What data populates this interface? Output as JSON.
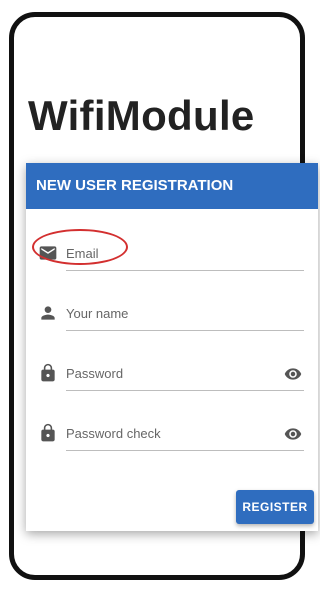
{
  "app": {
    "title": "WifiModule"
  },
  "card": {
    "header": "NEW USER REGISTRATION",
    "fields": [
      {
        "icon": "mail-icon",
        "label": "Email"
      },
      {
        "icon": "person-icon",
        "label": "Your name"
      },
      {
        "icon": "lock-icon",
        "label": "Password",
        "trailing_icon": "eye-icon"
      },
      {
        "icon": "lock-icon",
        "label": "Password check",
        "trailing_icon": "eye-icon"
      }
    ],
    "register_label": "REGISTER"
  },
  "colors": {
    "accent": "#2f6dbf",
    "highlight": "#d32f2f"
  }
}
